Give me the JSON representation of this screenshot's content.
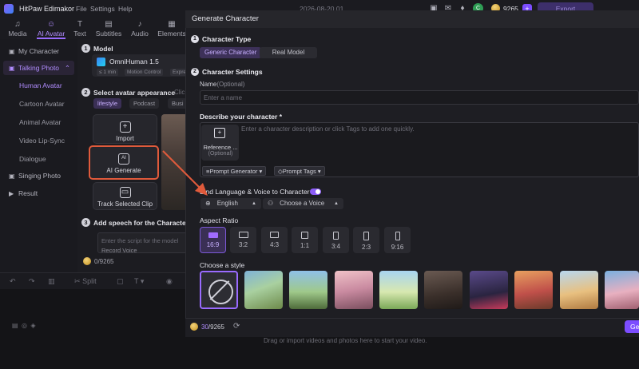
{
  "app": {
    "title": "HitPaw Edimakor",
    "menu": [
      "File",
      "Settings",
      "Help"
    ],
    "date": "2026-08-20 01",
    "avatar_letter": "C",
    "credits": "9265",
    "export_label": "Export"
  },
  "tabs": [
    {
      "icon": "♫",
      "label": "Media"
    },
    {
      "icon": "☺",
      "label": "AI Avatar"
    },
    {
      "icon": "T",
      "label": "Text"
    },
    {
      "icon": "▤",
      "label": "Subtitles"
    },
    {
      "icon": "♪",
      "label": "Audio"
    },
    {
      "icon": "▦",
      "label": "Elements"
    }
  ],
  "sidebar": {
    "items": [
      {
        "label": "My Character"
      },
      {
        "label": "Talking Photo"
      },
      {
        "label": "Human Avatar"
      },
      {
        "label": "Cartoon Avatar"
      },
      {
        "label": "Animal Avatar"
      },
      {
        "label": "Video Lip-Sync"
      },
      {
        "label": "Dialogue"
      },
      {
        "label": "Singing Photo"
      },
      {
        "label": "Result"
      }
    ]
  },
  "panel": {
    "model_section": "Model",
    "model_name": "OmniHuman 1.5",
    "model_chips": [
      "≤ 1 min",
      "Motion Control",
      "Expre"
    ],
    "appearance_section": "Select avatar appearance",
    "appearance_hint": "Clic",
    "filters": [
      "lifestyle",
      "Podcast",
      "Busi"
    ],
    "import_label": "Import",
    "ai_generate_label": "AI Generate",
    "track_clip_label": "Track Selected Clip",
    "speech_section": "Add speech for the Character",
    "speech_placeholder": "Enter the script for the model",
    "record_voice": "Record Voice",
    "credit": "0/9265"
  },
  "timeline": {
    "split_label": "Split",
    "drag_hint": "Drag or import videos and photos here to start your video."
  },
  "dialog": {
    "title": "Generate Character",
    "section1_title": "Character Type",
    "type_options": [
      "Generic Character",
      "Real Model"
    ],
    "section2_title": "Character Settings",
    "name_label": "Name",
    "name_optional": "(Optional)",
    "name_placeholder": "Enter a name",
    "describe_label": "Describe your character *",
    "reference_label": "Reference ...",
    "reference_optional": "(Optional)",
    "describe_placeholder": "Enter a character description or click Tags to add one quickly.",
    "prompt_generator": "Prompt Generator",
    "prompt_tags": "Prompt Tags",
    "bind_label": "Bind Language & Voice to Character",
    "language": "English",
    "voice": "Choose a Voice",
    "aspect_label": "Aspect Ratio",
    "aspect_ratios": [
      "16:9",
      "3:2",
      "4:3",
      "1:1",
      "3:4",
      "2:3",
      "9:16"
    ],
    "style_label": "Choose a style",
    "credit_used": "30",
    "credit_total": "/9265",
    "generate_label": "Ge"
  },
  "colors": {
    "accent": "#8b5cf6",
    "highlight_border": "#e05a3b",
    "background": "#151518"
  }
}
